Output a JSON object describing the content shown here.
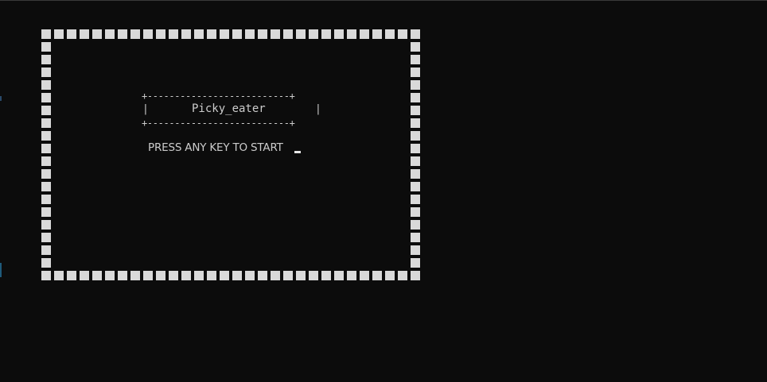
{
  "game": {
    "title_box_top": "+--------------------------+",
    "title_box_left": "|",
    "title_box_right": "|",
    "title": "Picky_eater",
    "title_box_bottom": "+--------------------------+",
    "prompt": "PRESS ANY KEY TO START",
    "border_color": "#d9d9d9",
    "background_color": "#0c0c0c"
  }
}
